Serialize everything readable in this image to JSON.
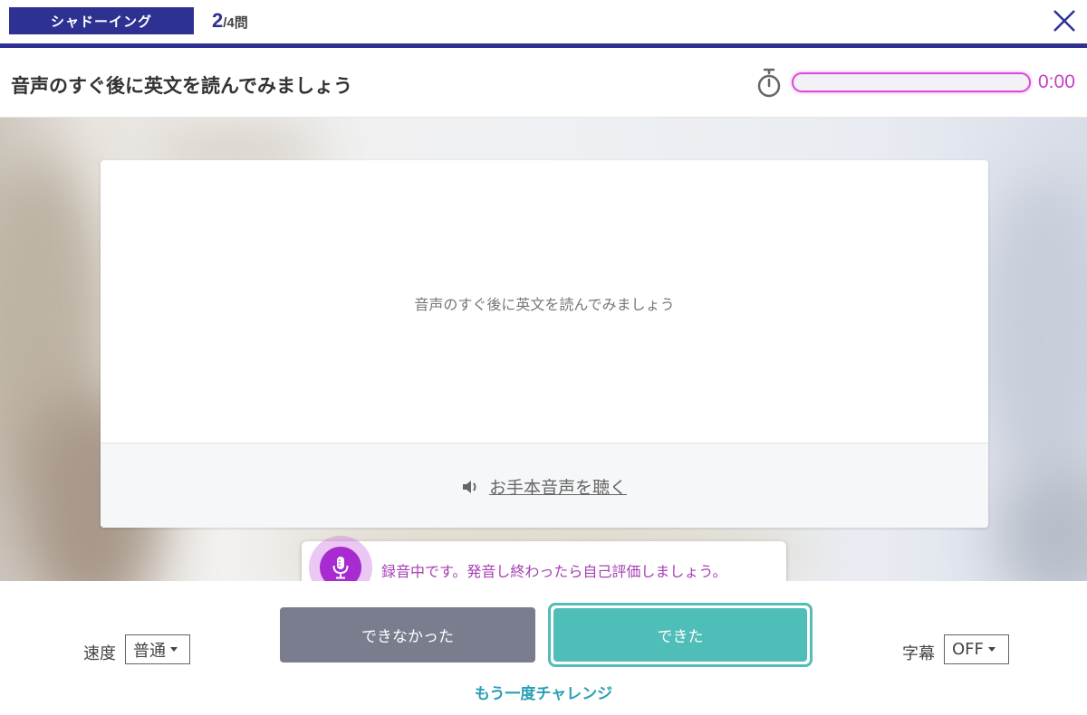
{
  "header": {
    "mode_label": "シャドーイング",
    "progress_current": "2",
    "progress_total": "/4",
    "progress_unit": "問"
  },
  "instruction": {
    "title": "音声のすぐ後に英文を読んでみましょう",
    "timer_text": "0:00",
    "timer_progress": 0
  },
  "card": {
    "prompt": "音声のすぐ後に英文を読んでみましょう",
    "listen_label": "お手本音声を聴く"
  },
  "recording": {
    "message": "録音中です。発音し終わったら自己評価しましょう。"
  },
  "controls": {
    "speed_label": "速度",
    "speed_value": "普通",
    "subtitle_label": "字幕",
    "subtitle_value": "OFF",
    "fail_button": "できなかった",
    "success_button": "できた",
    "retry_link": "もう一度チャレンジ"
  },
  "colors": {
    "brand": "#2e3192",
    "timer_accent": "#d84bd6",
    "success": "#4fbdb8",
    "fail": "#7a7d8e",
    "retry": "#2a9fb5"
  },
  "icons": {
    "close": "close-icon",
    "timer": "stopwatch-icon",
    "speaker": "speaker-icon",
    "mic": "microphone-icon"
  }
}
